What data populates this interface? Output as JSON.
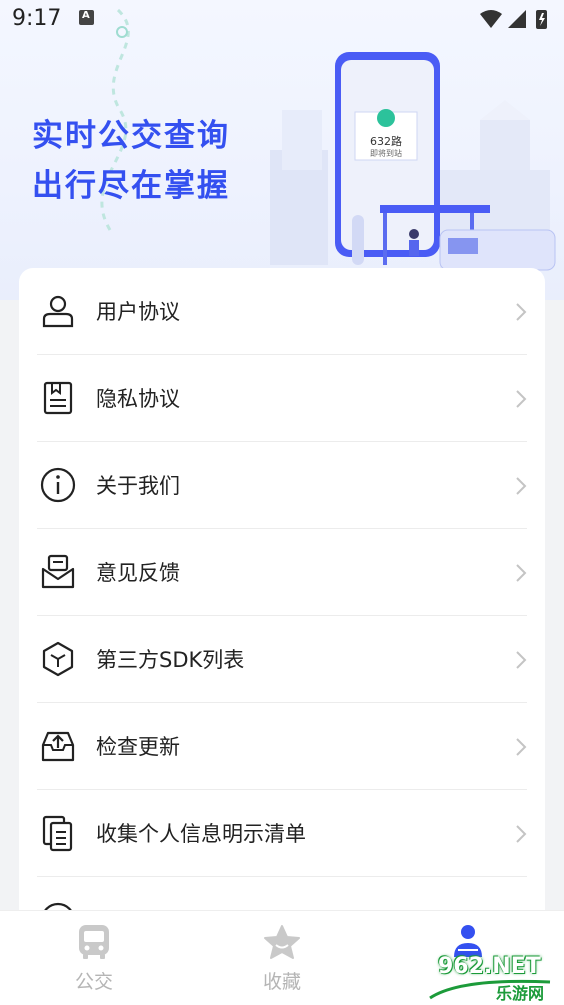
{
  "status_bar": {
    "time": "9:17"
  },
  "banner": {
    "line1": "实时公交查询",
    "line2": "出行尽在掌握",
    "phone_route": "632路",
    "phone_sub": "即将到站"
  },
  "menu": {
    "items": [
      {
        "label": "用户协议",
        "icon": "user-agreement-icon"
      },
      {
        "label": "隐私协议",
        "icon": "privacy-icon"
      },
      {
        "label": "关于我们",
        "icon": "info-icon"
      },
      {
        "label": "意见反馈",
        "icon": "feedback-icon"
      },
      {
        "label": "第三方SDK列表",
        "icon": "cube-icon"
      },
      {
        "label": "检查更新",
        "icon": "update-icon"
      },
      {
        "label": "收集个人信息明示清单",
        "icon": "document-list-icon"
      }
    ]
  },
  "tabbar": {
    "tabs": [
      {
        "label": "公交",
        "icon": "bus-icon"
      },
      {
        "label": "收藏",
        "icon": "star-icon"
      }
    ]
  },
  "watermark": {
    "brand": "962.NET",
    "sub": "乐游网"
  },
  "colors": {
    "accent": "#3450f0",
    "text": "#222222",
    "tab_inactive": "#b5b5b5"
  }
}
